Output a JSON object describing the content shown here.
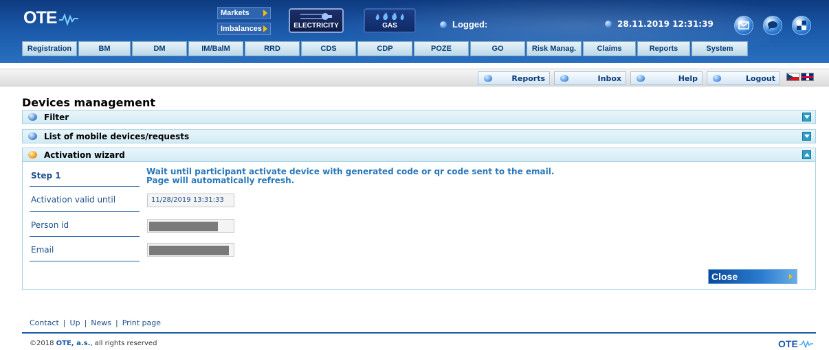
{
  "header": {
    "logo_text": "OTE",
    "markets_label": "Markets",
    "imbalances_label": "Imbalances",
    "electricity_label": "ELECTRICITY",
    "gas_label": "GAS",
    "logged_label": "Logged:",
    "datetime": "28.11.2019 12:31:39",
    "icons": [
      "mail-icon",
      "chat-icon",
      "tiles-icon"
    ]
  },
  "menu": {
    "items": [
      {
        "label": "Registration"
      },
      {
        "label": "BM"
      },
      {
        "label": "DM"
      },
      {
        "label": "IM/BalM"
      },
      {
        "label": "RRD"
      },
      {
        "label": "CDS"
      },
      {
        "label": "CDP"
      },
      {
        "label": "POZE"
      },
      {
        "label": "GO"
      },
      {
        "label": "Risk Manag."
      },
      {
        "label": "Claims"
      },
      {
        "label": "Reports"
      },
      {
        "label": "System"
      }
    ]
  },
  "subbar": {
    "reports": "Reports",
    "inbox": "Inbox",
    "help": "Help",
    "logout": "Logout"
  },
  "page": {
    "title": "Devices management",
    "panels": {
      "filter": "Filter",
      "list": "List of mobile devices/requests",
      "wizard": "Activation wizard"
    }
  },
  "wizard": {
    "step_label": "Step 1",
    "instruction": "Wait until participant activate device with generated code or qr code sent to the email. Page will automatically refresh.",
    "activation_label": "Activation valid until",
    "activation_value": "11/28/2019 13:31:33",
    "person_label": "Person id",
    "email_label": "Email",
    "close_label": "Close"
  },
  "footer": {
    "contact": "Contact",
    "up": "Up",
    "news": "News",
    "print": "Print page",
    "sep": "|",
    "copyright_prefix": "©2018",
    "company": "OTE, a.s.",
    "copyright_suffix": ", all rights reserved",
    "logo_text": "OTE"
  },
  "colors": {
    "header_blue": "#1a58a8",
    "panel_head": "#d2ebf4",
    "label_blue": "#1f4f8a",
    "instruction_blue": "#2a78b8",
    "accent_yellow": "#f5c200"
  }
}
